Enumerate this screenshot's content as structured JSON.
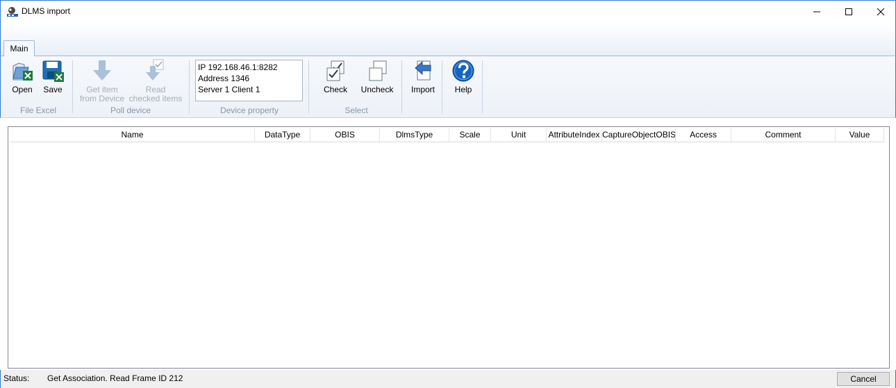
{
  "window": {
    "title": "DLMS import",
    "app_icon": "gurux-icon",
    "controls": {
      "minimize": "minimize-icon",
      "maximize": "maximize-icon",
      "close": "close-icon"
    }
  },
  "ribbon": {
    "tabs": [
      {
        "label": "Main",
        "selected": true
      }
    ],
    "groups": {
      "file_excel": {
        "label": "File Excel",
        "buttons": [
          {
            "label": "Open",
            "icon": "open-excel-icon",
            "enabled": true
          },
          {
            "label": "Save",
            "icon": "save-excel-icon",
            "enabled": true
          }
        ]
      },
      "poll_device": {
        "label": "Poll device",
        "buttons": [
          {
            "line1": "Get item",
            "line2": "from Device",
            "icon": "down-arrow-icon",
            "enabled": false
          },
          {
            "line1": "Read",
            "line2": "checked items",
            "icon": "read-checked-icon",
            "enabled": false
          }
        ]
      },
      "device_property": {
        "label": "Device property",
        "lines": [
          "IP 192.168.46.1:8282",
          "Address 1346",
          "Server 1 Client 1"
        ]
      },
      "select": {
        "label": "Select",
        "buttons": [
          {
            "label": "Check",
            "icon": "check-icon",
            "enabled": true
          },
          {
            "label": "Uncheck",
            "icon": "uncheck-icon",
            "enabled": true
          }
        ]
      },
      "import": {
        "label": "Import",
        "icon": "import-icon"
      },
      "help": {
        "label": "Help",
        "icon": "help-icon"
      }
    }
  },
  "grid": {
    "columns": [
      "Name",
      "DataType",
      "OBIS",
      "DlmsType",
      "Scale",
      "Unit",
      "AttributeIndex",
      "CaptureObjectOBIS",
      "Access",
      "Comment",
      "Value"
    ],
    "rows": []
  },
  "status": {
    "label": "Status:",
    "text": "Get Association. Read Frame ID 212",
    "cancel_label": "Cancel"
  },
  "colors": {
    "window_border": "#2b79d0",
    "ribbon_background": "#edf1f7",
    "disabled_text": "#a5adb8",
    "group_label": "#8b95a3",
    "excel_green": "#1f7a3a",
    "help_blue": "#1565c0"
  }
}
